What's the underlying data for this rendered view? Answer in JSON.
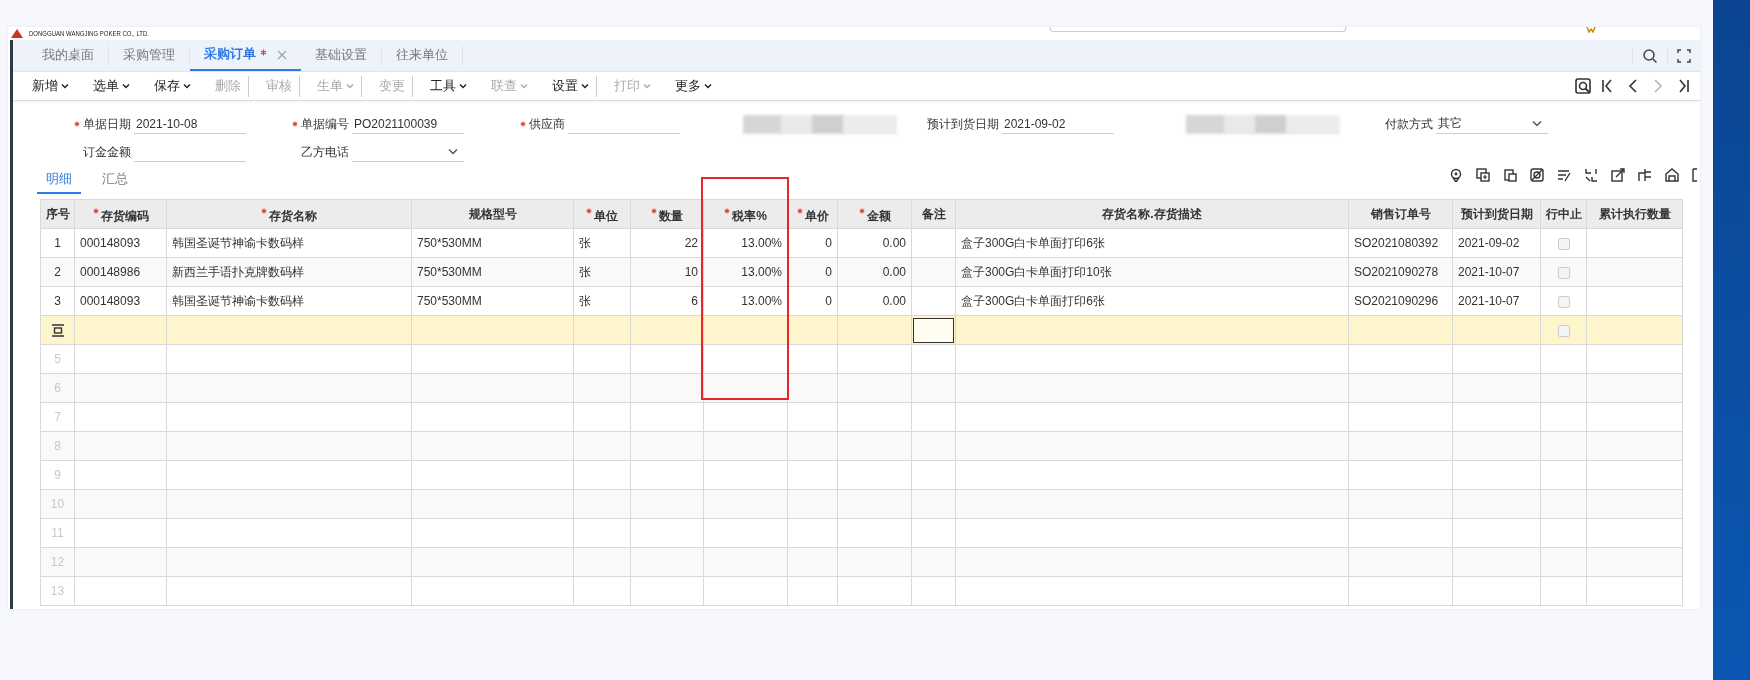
{
  "header": {
    "company": "DONGGUAN WANGJING POKER CO., LTD."
  },
  "tabs": [
    {
      "label": "我的桌面",
      "selected": false,
      "modified": false,
      "closable": false
    },
    {
      "label": "采购管理",
      "selected": false,
      "modified": false,
      "closable": false
    },
    {
      "label": "采购订单",
      "selected": true,
      "modified": true,
      "closable": true
    },
    {
      "label": "基础设置",
      "selected": false,
      "modified": false,
      "closable": false
    },
    {
      "label": "往来单位",
      "selected": false,
      "modified": false,
      "closable": false
    }
  ],
  "toolbar": [
    {
      "label": "新增",
      "dropdown": true,
      "disabled": false,
      "separator_after": false
    },
    {
      "label": "选单",
      "dropdown": true,
      "disabled": false,
      "separator_after": false
    },
    {
      "label": "保存",
      "dropdown": true,
      "disabled": false,
      "separator_after": false
    },
    {
      "label": "删除",
      "dropdown": false,
      "disabled": true,
      "separator_after": true
    },
    {
      "label": "审核",
      "dropdown": false,
      "disabled": true,
      "separator_after": true
    },
    {
      "label": "生单",
      "dropdown": true,
      "disabled": true,
      "separator_after": true
    },
    {
      "label": "变更",
      "dropdown": false,
      "disabled": true,
      "separator_after": true
    },
    {
      "label": "工具",
      "dropdown": true,
      "disabled": false,
      "separator_after": false
    },
    {
      "label": "联查",
      "dropdown": true,
      "disabled": true,
      "separator_after": false
    },
    {
      "label": "设置",
      "dropdown": true,
      "disabled": false,
      "separator_after": true
    },
    {
      "label": "打印",
      "dropdown": true,
      "disabled": true,
      "separator_after": false
    },
    {
      "label": "更多",
      "dropdown": true,
      "disabled": false,
      "separator_after": false
    }
  ],
  "nav": [
    {
      "kind": "preview",
      "disabled": false
    },
    {
      "kind": "first",
      "disabled": false
    },
    {
      "kind": "prev",
      "disabled": false
    },
    {
      "kind": "next",
      "disabled": true
    },
    {
      "kind": "last",
      "disabled": false
    }
  ],
  "form": {
    "rows": [
      [
        {
          "kind": "text",
          "label": "单据日期",
          "required": true,
          "value": "2021-10-08"
        },
        {
          "kind": "text",
          "label": "单据编号",
          "required": true,
          "value": "PO2021100039"
        },
        {
          "kind": "text",
          "label": "供应商",
          "required": true
        },
        {
          "kind": "blurred"
        },
        {
          "kind": "text",
          "label": "预计到货日期",
          "required": false,
          "value": "2021-09-02"
        },
        {
          "kind": "blurred"
        },
        {
          "kind": "select",
          "label": "付款方式",
          "required": false,
          "value": "其它"
        }
      ],
      [
        {
          "kind": "text",
          "label": "订金金额",
          "required": false
        },
        {
          "kind": "select",
          "label": "乙方电话",
          "required": false
        }
      ]
    ]
  },
  "detail_tabs": [
    {
      "label": "明细",
      "selected": true
    },
    {
      "label": "汇总",
      "selected": false
    }
  ],
  "table": {
    "columns": [
      {
        "label": "序号",
        "required": false,
        "kind": "index"
      },
      {
        "label": "存货编码",
        "required": true,
        "kind": "text"
      },
      {
        "label": "存货名称",
        "required": true,
        "kind": "text"
      },
      {
        "label": "规格型号",
        "required": false,
        "kind": "text"
      },
      {
        "label": "单位",
        "required": true,
        "kind": "text"
      },
      {
        "label": "数量",
        "required": true,
        "kind": "number"
      },
      {
        "label": "税率%",
        "required": true,
        "kind": "number"
      },
      {
        "label": "单价",
        "required": true,
        "kind": "number"
      },
      {
        "label": "金额",
        "required": true,
        "kind": "number"
      },
      {
        "label": "备注",
        "required": false,
        "kind": "memo"
      },
      {
        "label": "存货名称.存货描述",
        "required": false,
        "kind": "text"
      },
      {
        "label": "销售订单号",
        "required": false,
        "kind": "text"
      },
      {
        "label": "预计到货日期",
        "required": false,
        "kind": "text"
      },
      {
        "label": "行中止",
        "required": false,
        "kind": "check"
      },
      {
        "label": "累计执行数量",
        "required": false,
        "kind": "number"
      }
    ],
    "rows": [
      {
        "kind": "data",
        "line_stopped": false,
        "cells": [
          "1",
          "000148093",
          "韩国圣诞节神谕卡数码样",
          "750*530MM",
          "张",
          "22",
          "13.00%",
          "0",
          "0.00",
          null,
          "盒子300G白卡单面打印6张",
          "SO2021080392",
          "2021-09-02",
          null,
          null
        ]
      },
      {
        "kind": "data",
        "line_stopped": false,
        "cells": [
          "2",
          "000148986",
          "新西兰手语扑克牌数码样",
          "750*530MM",
          "张",
          "10",
          "13.00%",
          "0",
          "0.00",
          null,
          "盒子300G白卡单面打印10张",
          "SO2021090278",
          "2021-10-07",
          null,
          null
        ]
      },
      {
        "kind": "data",
        "line_stopped": false,
        "cells": [
          "3",
          "000148093",
          "韩国圣诞节神谕卡数码样",
          "750*530MM",
          "张",
          "6",
          "13.00%",
          "0",
          "0.00",
          null,
          "盒子300G白卡单面打印6张",
          "SO2021090296",
          "2021-10-07",
          null,
          null
        ]
      },
      {
        "kind": "new",
        "line_stopped": false,
        "editing": true
      },
      {
        "kind": "blank",
        "number": "5"
      },
      {
        "kind": "blank",
        "number": "6"
      },
      {
        "kind": "blank",
        "number": "7"
      },
      {
        "kind": "blank",
        "number": "8"
      },
      {
        "kind": "blank",
        "number": "9"
      },
      {
        "kind": "blank",
        "number": "10"
      },
      {
        "kind": "blank",
        "number": "11"
      },
      {
        "kind": "blank",
        "number": "12"
      },
      {
        "kind": "blank",
        "number": "13"
      }
    ]
  },
  "annotations": [
    {
      "kind": "rectangle"
    }
  ]
}
